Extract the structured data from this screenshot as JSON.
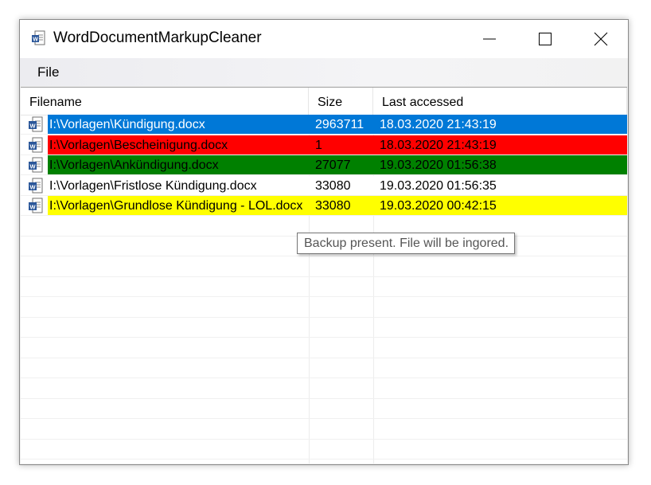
{
  "window": {
    "title": "WordDocumentMarkupCleaner",
    "controls": {
      "minimize": "minimize",
      "maximize": "maximize",
      "close": "close"
    }
  },
  "menu": {
    "file": "File"
  },
  "table": {
    "columns": [
      "Filename",
      "Size",
      "Last accessed"
    ],
    "rows": [
      {
        "filename": "I:\\Vorlagen\\Kündigung.docx",
        "size": "2963711",
        "accessed": "18.03.2020 21:43:19",
        "bg": "#0078d7",
        "fg": "#ffffff",
        "state": "selected"
      },
      {
        "filename": "I:\\Vorlagen\\Bescheinigung.docx",
        "size": "1",
        "accessed": "18.03.2020 21:43:19",
        "bg": "#ff0000",
        "fg": "#000000",
        "state": "red"
      },
      {
        "filename": "I:\\Vorlagen\\Ankündigung.docx",
        "size": "27077",
        "accessed": "19.03.2020 01:56:38",
        "bg": "#008000",
        "fg": "#000000",
        "state": "green"
      },
      {
        "filename": "I:\\Vorlagen\\Fristlose Kündigung.docx",
        "size": "33080",
        "accessed": "19.03.2020 01:56:35",
        "bg": "#ffffff",
        "fg": "#000000",
        "state": "normal"
      },
      {
        "filename": "I:\\Vorlagen\\Grundlose Kündigung - LOL.docx",
        "size": "33080",
        "accessed": "19.03.2020 00:42:15",
        "bg": "#ffff00",
        "fg": "#000000",
        "state": "yellow"
      }
    ]
  },
  "tooltip": {
    "text": "Backup present. File will be ingored."
  },
  "icons": {
    "app": "word-document-icon",
    "row": "word-document-icon"
  }
}
